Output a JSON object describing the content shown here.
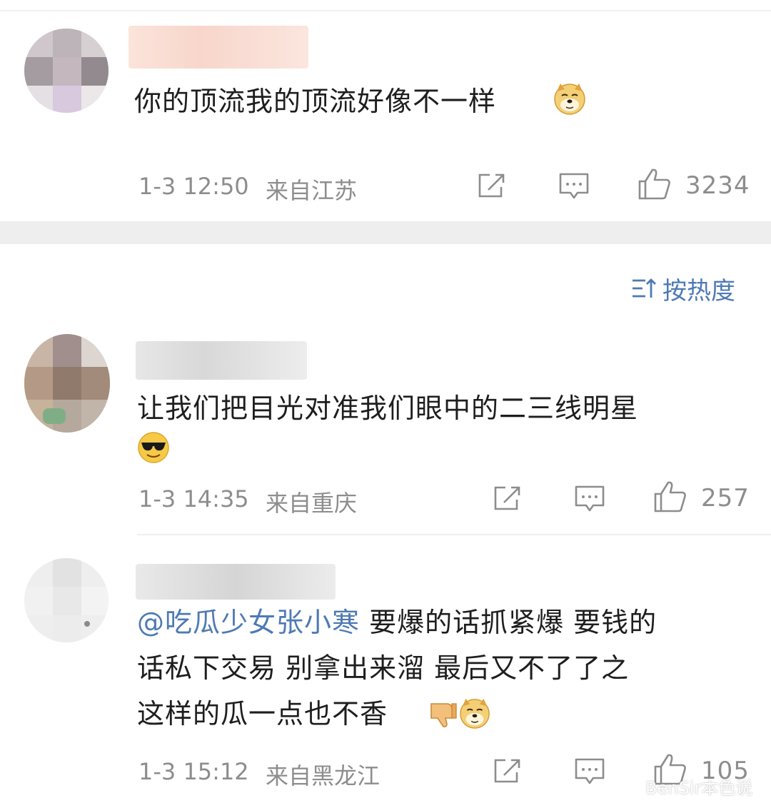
{
  "comments": [
    {
      "text": "你的顶流我的顶流好像不一样",
      "time": "1-3 12:50",
      "location": "来自江苏",
      "likes": "3234",
      "emoji": "doge-emoji"
    },
    {
      "text": "让我们把目光对准我们眼中的二三线明星",
      "time": "1-3 14:35",
      "location": "来自重庆",
      "likes": "257",
      "emoji": "cool-sunglasses-emoji"
    },
    {
      "mention": "@吃瓜少女张小寒",
      "text_line1": " 要爆的话抓紧爆  要钱的",
      "text_line2": "话私下交易  别拿出来溜 最后又不了了之",
      "text_line3": "这样的瓜一点也不香",
      "time": "1-3 15:12",
      "location": "来自黑龙江",
      "likes": "105",
      "emoji": "doge-emoji"
    }
  ],
  "sort": {
    "label": "按热度",
    "icon": "sort-icon"
  },
  "watermark": "BenSir本色说",
  "colors": {
    "link_blue": "#4e7ab4",
    "meta_gray": "#8d8d8d",
    "section_gap": "#eeeeee"
  }
}
